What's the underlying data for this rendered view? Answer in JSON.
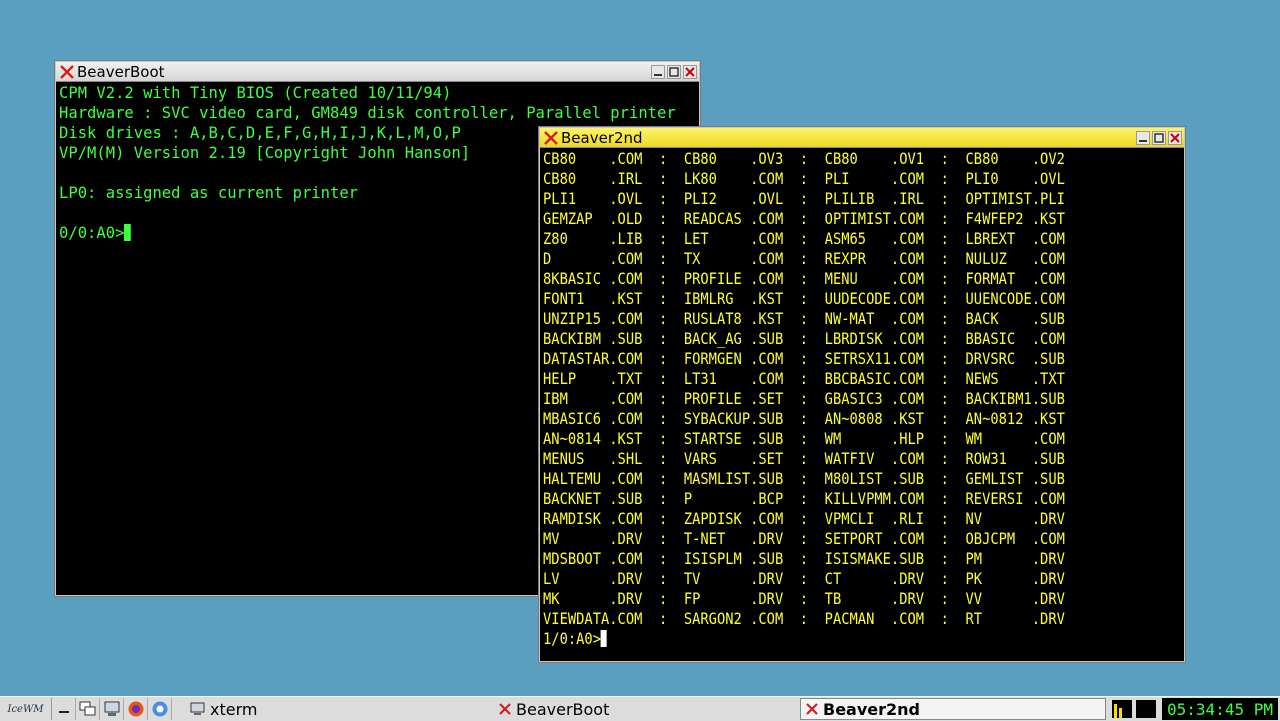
{
  "windows": {
    "boot": {
      "title": "BeaverBoot",
      "lines": [
        "CPM V2.2 with Tiny BIOS (Created 10/11/94)",
        "Hardware : SVC video card, GM849 disk controller, Parallel printer",
        "Disk drives : A,B,C,D,E,F,G,H,I,J,K,L,M,O,P",
        "VP/M(M) Version 2.19 [Copyright John Hanson]",
        "",
        "LP0: assigned as current printer",
        ""
      ],
      "prompt": "0/0:A0>"
    },
    "second": {
      "title": "Beaver2nd",
      "lines": [
        "CB80    .COM  :  CB80    .OV3  :  CB80    .OV1  :  CB80    .OV2",
        "CB80    .IRL  :  LK80    .COM  :  PLI     .COM  :  PLI0    .OVL",
        "PLI1    .OVL  :  PLI2    .OVL  :  PLILIB  .IRL  :  OPTIMIST.PLI",
        "GEMZAP  .OLD  :  READCAS .COM  :  OPTIMIST.COM  :  F4WFEP2 .KST",
        "Z80     .LIB  :  LET     .COM  :  ASM65   .COM  :  LBREXT  .COM",
        "D       .COM  :  TX      .COM  :  REXPR   .COM  :  NULUZ   .COM",
        "8KBASIC .COM  :  PROFILE .COM  :  MENU    .COM  :  FORMAT  .COM",
        "FONT1   .KST  :  IBMLRG  .KST  :  UUDECODE.COM  :  UUENCODE.COM",
        "UNZIP15 .COM  :  RUSLAT8 .KST  :  NW-MAT  .COM  :  BACK    .SUB",
        "BACKIBM .SUB  :  BACK_AG .SUB  :  LBRDISK .COM  :  BBASIC  .COM",
        "DATASTAR.COM  :  FORMGEN .COM  :  SETRSX11.COM  :  DRVSRC  .SUB",
        "HELP    .TXT  :  LT31    .COM  :  BBCBASIC.COM  :  NEWS    .TXT",
        "IBM     .COM  :  PROFILE .SET  :  GBASIC3 .COM  :  BACKIBM1.SUB",
        "MBASIC6 .COM  :  SYBACKUP.SUB  :  AN~0808 .KST  :  AN~0812 .KST",
        "AN~0814 .KST  :  STARTSE .SUB  :  WM      .HLP  :  WM      .COM",
        "MENUS   .SHL  :  VARS    .SET  :  WATFIV  .COM  :  ROW31   .SUB",
        "HALTEMU .COM  :  MASMLIST.SUB  :  M80LIST .SUB  :  GEMLIST .SUB",
        "BACKNET .SUB  :  P       .BCP  :  KILLVPMM.COM  :  REVERSI .COM",
        "RAMDISK .COM  :  ZAPDISK .COM  :  VPMCLI  .RLI  :  NV      .DRV",
        "MV      .DRV  :  T-NET   .DRV  :  SETPORT .COM  :  OBJCPM  .COM",
        "MDSBOOT .COM  :  ISISPLM .SUB  :  ISISMAKE.SUB  :  PM      .DRV",
        "LV      .DRV  :  TV      .DRV  :  CT      .DRV  :  PK      .DRV",
        "MK      .DRV  :  FP      .DRV  :  TB      .DRV  :  VV      .DRV",
        "VIEWDATA.COM  :  SARGON2 .COM  :  PACMAN  .COM  :  RT      .DRV"
      ],
      "prompt": "1/0:A0>"
    }
  },
  "taskbar": {
    "start_label": "IceWM",
    "tasks": [
      {
        "label": "xterm"
      },
      {
        "label": "BeaverBoot"
      },
      {
        "label": "Beaver2nd"
      }
    ],
    "clock": "05:34:45 PM"
  },
  "colors": {
    "desktop": "#5a9fc0",
    "term_green": "#40ff40",
    "term_yellow": "#ffff30",
    "active_title": "#fff46a"
  }
}
